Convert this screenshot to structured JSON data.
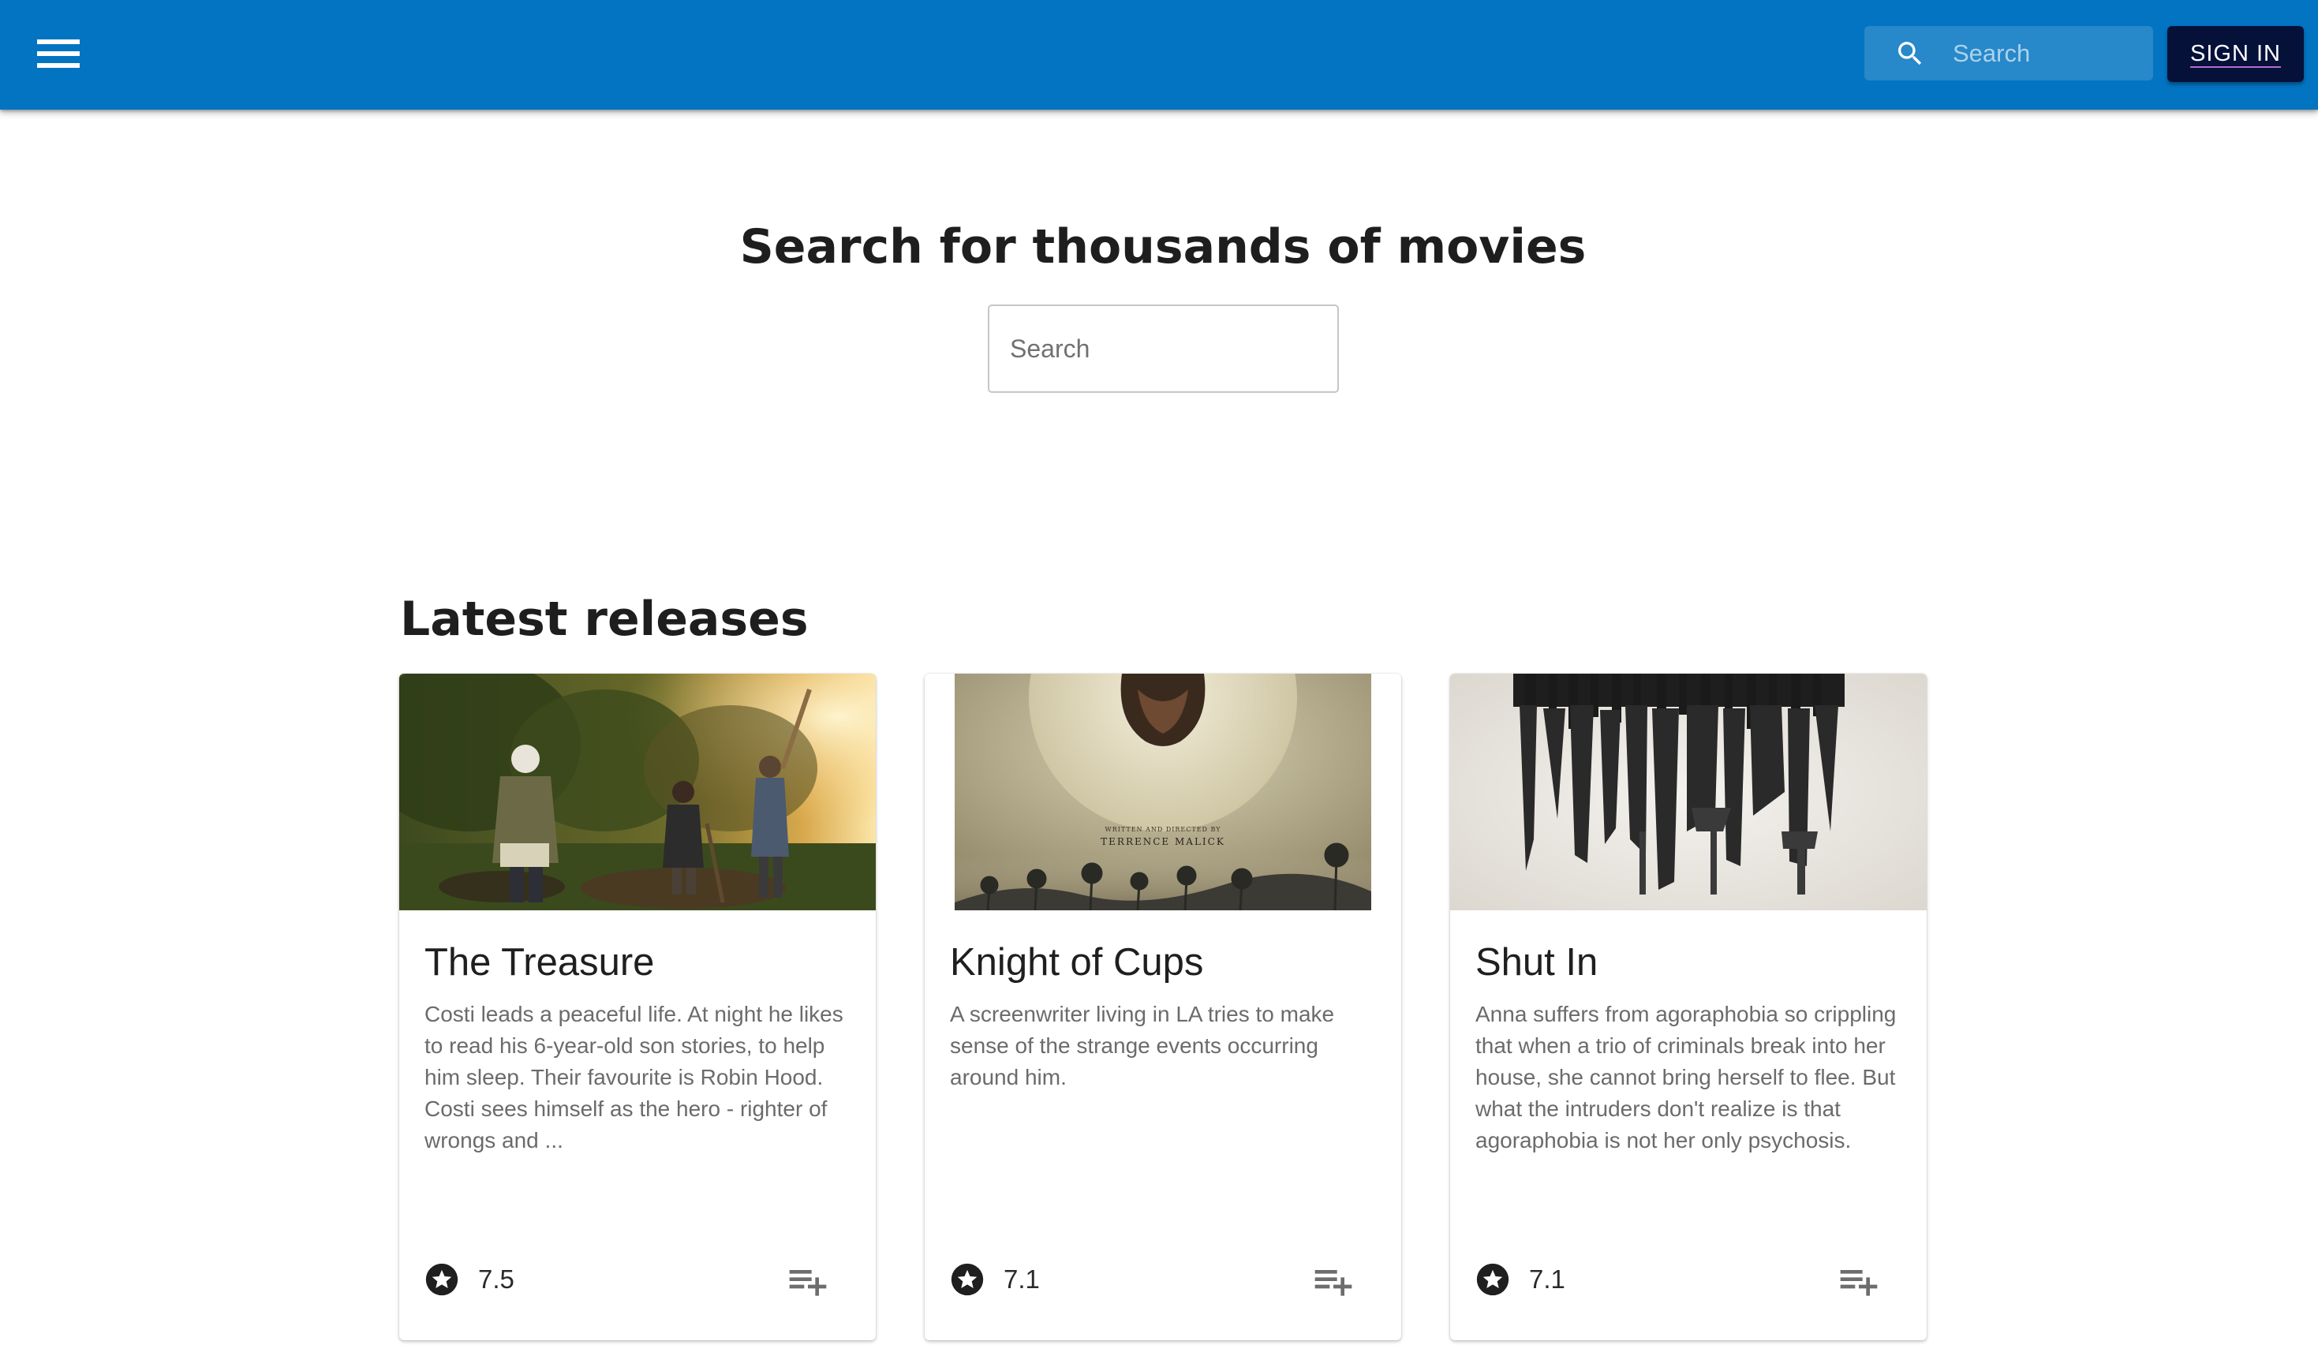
{
  "header": {
    "menu_icon": "menu-icon",
    "search_icon": "search-icon",
    "search_placeholder": "Search",
    "signin_label": "SIGN IN",
    "accent_color": "#0274c1",
    "signin_color": "#06113a"
  },
  "hero": {
    "title": "Search for thousands of movies",
    "search_placeholder": "Search"
  },
  "latest": {
    "title": "Latest releases",
    "movies": [
      {
        "title": "The Treasure",
        "description": "Costi leads a peaceful life. At night he likes to read his 6-year-old son stories, to help him sleep. Their favourite is Robin Hood. Costi sees himself as the hero - righter of wrongs and ...",
        "rating": "7.5",
        "rating_icon": "star-icon",
        "action_icon": "playlist-add-icon"
      },
      {
        "title": "Knight of Cups",
        "description": "A screenwriter living in LA tries to make sense of the strange events occurring around him.",
        "rating": "7.1",
        "rating_icon": "star-icon",
        "action_icon": "playlist-add-icon",
        "poster_text_1": "WRITTEN AND DIRECTED BY",
        "poster_text_2": "TERRENCE MALICK"
      },
      {
        "title": "Shut In",
        "description": "Anna suffers from agoraphobia so crippling that when a trio of criminals break into her house, she cannot bring herself to flee. But what the intruders don't realize is that agoraphobia is not her only psychosis.",
        "rating": "7.1",
        "rating_icon": "star-icon",
        "action_icon": "playlist-add-icon"
      }
    ]
  }
}
